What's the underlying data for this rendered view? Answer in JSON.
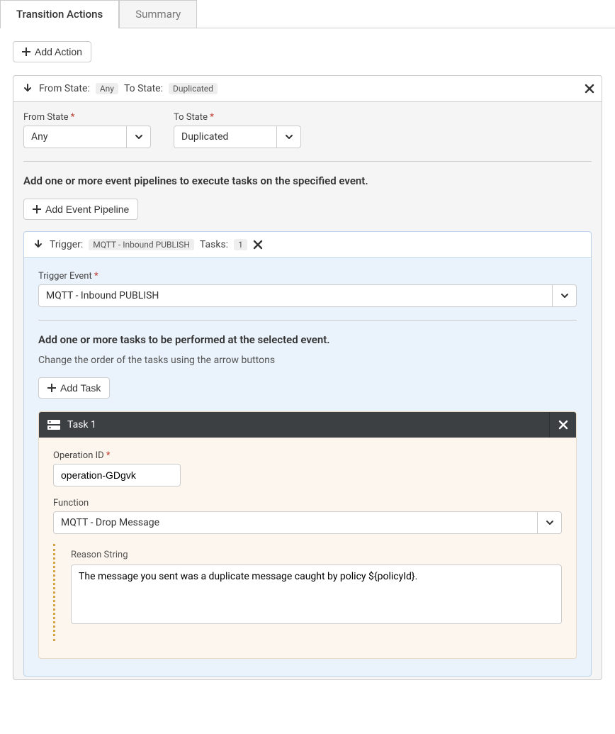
{
  "tabs": {
    "active": "Transition Actions",
    "inactive": "Summary"
  },
  "buttons": {
    "add_action": "Add Action",
    "add_event_pipeline": "Add Event Pipeline",
    "add_task": "Add Task"
  },
  "transition_header": {
    "from_label": "From State:",
    "from_value": "Any",
    "to_label": "To State:",
    "to_value": "Duplicated"
  },
  "fields": {
    "from_state_label": "From State",
    "from_state_value": "Any",
    "to_state_label": "To State",
    "to_state_value": "Duplicated"
  },
  "section_text": {
    "pipelines_title": "Add one or more event pipelines to execute tasks on the specified event.",
    "tasks_title": "Add one or more tasks to be performed at the selected event.",
    "tasks_subtext": "Change the order of the tasks using the arrow buttons"
  },
  "pipeline_header": {
    "trigger_label": "Trigger:",
    "trigger_value": "MQTT - Inbound PUBLISH",
    "tasks_label": "Tasks:",
    "tasks_count": "1"
  },
  "trigger_field": {
    "label": "Trigger Event",
    "value": "MQTT - Inbound PUBLISH"
  },
  "task": {
    "title": "Task 1",
    "operation_id_label": "Operation ID",
    "operation_id_value": "operation-GDgvk",
    "function_label": "Function",
    "function_value": "MQTT - Drop Message",
    "reason_label": "Reason String",
    "reason_value": "The message you sent was a duplicate message caught by policy ${policyId}."
  }
}
